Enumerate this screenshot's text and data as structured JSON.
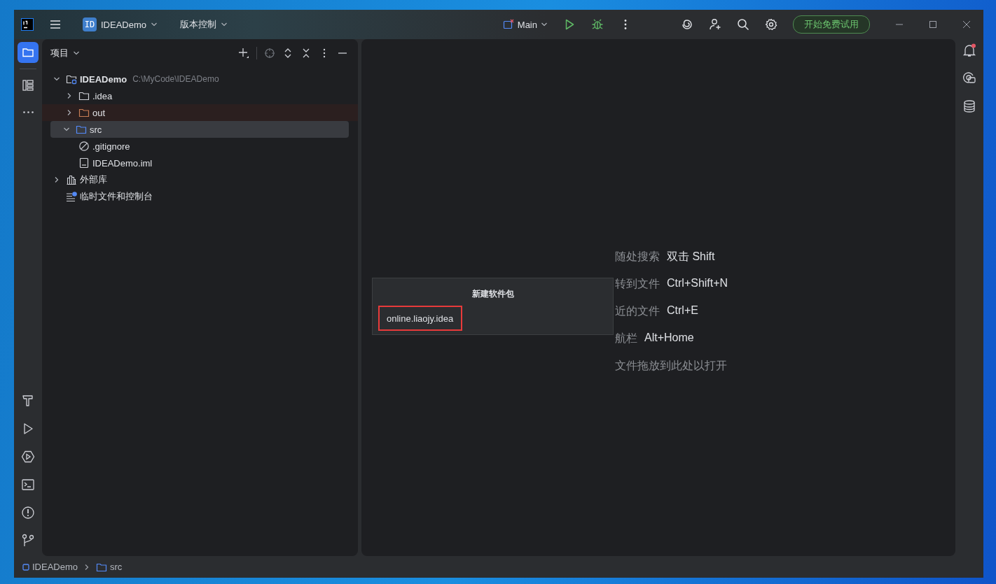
{
  "toolbar": {
    "project_badge": "ID",
    "project_name": "IDEADemo",
    "vcs_menu": "版本控制",
    "run_config": "Main",
    "trial_button": "开始免费试用"
  },
  "left_tools": [
    {
      "kind": "project",
      "selected": true
    },
    {
      "kind": "structure",
      "selected": false
    },
    {
      "kind": "more",
      "selected": false
    }
  ],
  "bottom_tools": [
    {
      "kind": "build"
    },
    {
      "kind": "run"
    },
    {
      "kind": "services"
    },
    {
      "kind": "terminal"
    },
    {
      "kind": "problems"
    },
    {
      "kind": "git"
    }
  ],
  "project_panel": {
    "title": "项目",
    "tree": [
      {
        "name": "IDEADemo",
        "kind": "module",
        "hint": "C:\\MyCode\\IDEADemo",
        "expanded": true,
        "selected": false,
        "children": [
          {
            "name": ".idea",
            "kind": "folder",
            "expanded": false,
            "selected": false
          },
          {
            "name": "out",
            "kind": "excluded-folder",
            "expanded": false,
            "selected": false
          },
          {
            "name": "src",
            "kind": "source-folder",
            "expanded": true,
            "selected": true
          },
          {
            "name": ".gitignore",
            "kind": "ignore-file",
            "selected": false
          },
          {
            "name": "IDEADemo.iml",
            "kind": "iml-file",
            "selected": false
          }
        ]
      },
      {
        "name": "外部库",
        "kind": "library",
        "expanded": false,
        "selected": false
      },
      {
        "name": "临时文件和控制台",
        "kind": "scratch",
        "selected": false
      }
    ]
  },
  "editor_hints": [
    {
      "label": "随处搜索",
      "shortcut": "双击 Shift"
    },
    {
      "label": "转到文件",
      "shortcut": "Ctrl+Shift+N"
    },
    {
      "label": "近的文件",
      "shortcut": "Ctrl+E"
    },
    {
      "label": "航栏",
      "shortcut": "Alt+Home"
    },
    {
      "label": "文件拖放到此处以打开"
    }
  ],
  "popup": {
    "title": "新建软件包",
    "value": "online.liaojy.idea"
  },
  "notifications": {
    "unread": true
  },
  "breadcrumbs": [
    {
      "label": "IDEADemo",
      "kind": "module"
    },
    {
      "label": "src",
      "kind": "folder"
    }
  ]
}
